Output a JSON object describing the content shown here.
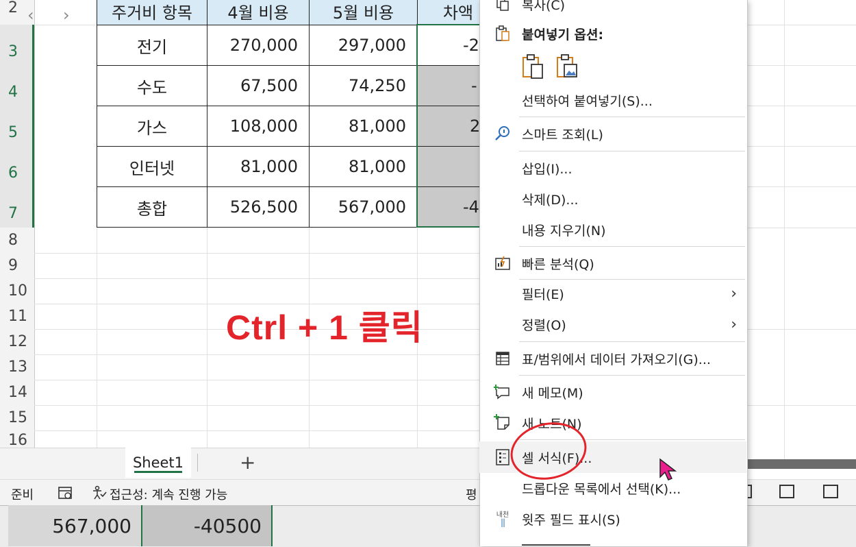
{
  "spreadsheet": {
    "row_numbers": [
      "2",
      "3",
      "4",
      "5",
      "6",
      "7",
      "8",
      "9",
      "10",
      "11",
      "12",
      "13",
      "14",
      "15",
      "16"
    ],
    "headers": [
      "주거비 항목",
      "4월 비용",
      "5월 비용",
      "차액"
    ],
    "rows": [
      {
        "item": "전기",
        "april": "270,000",
        "may": "297,000",
        "diff": "-2"
      },
      {
        "item": "수도",
        "april": "67,500",
        "may": "74,250",
        "diff": "-"
      },
      {
        "item": "가스",
        "april": "108,000",
        "may": "81,000",
        "diff": "2"
      },
      {
        "item": "인터넷",
        "april": "81,000",
        "may": "81,000",
        "diff": ""
      },
      {
        "item": "총합",
        "april": "526,500",
        "may": "567,000",
        "diff": "-4"
      }
    ],
    "annotation": "Ctrl + 1 클릭"
  },
  "sheet_tabs": {
    "prev_arrow": "‹",
    "next_arrow": "›",
    "active_tab": "Sheet1",
    "add_sheet": "+"
  },
  "status_bar": {
    "ready": "준비",
    "accessibility": "접근성: 계속 진행 가능",
    "partial": "평"
  },
  "bottom_strip": {
    "value1": "567,000",
    "value2": "-40500"
  },
  "context_menu": {
    "copy": "복사(C)",
    "paste_options": "붙여넣기 옵션:",
    "paste_special": "선택하여 붙여넣기(S)...",
    "smart_lookup": "스마트 조회(L)",
    "insert": "삽입(I)...",
    "delete": "삭제(D)...",
    "clear_contents": "내용 지우기(N)",
    "quick_analysis": "빠른 분석(Q)",
    "filter": "필터(E)",
    "sort": "정렬(O)",
    "get_data": "표/범위에서 데이터 가져오기(G)...",
    "new_comment": "새 메모(M)",
    "new_note": "새 노트(N)",
    "format_cells": "셀 서식(F)...",
    "dropdown": "드롭다운 목록에서 선택(K)...",
    "phonetic": "윗주 필드 표시(S)",
    "phonetic_icon_text": "내천",
    "submenu_arrow": "›"
  },
  "colors": {
    "excel_green": "#217346",
    "annotation_red": "#e3242b",
    "header_fill": "#d9eaf7",
    "diff_fill": "#c9c9c9"
  }
}
